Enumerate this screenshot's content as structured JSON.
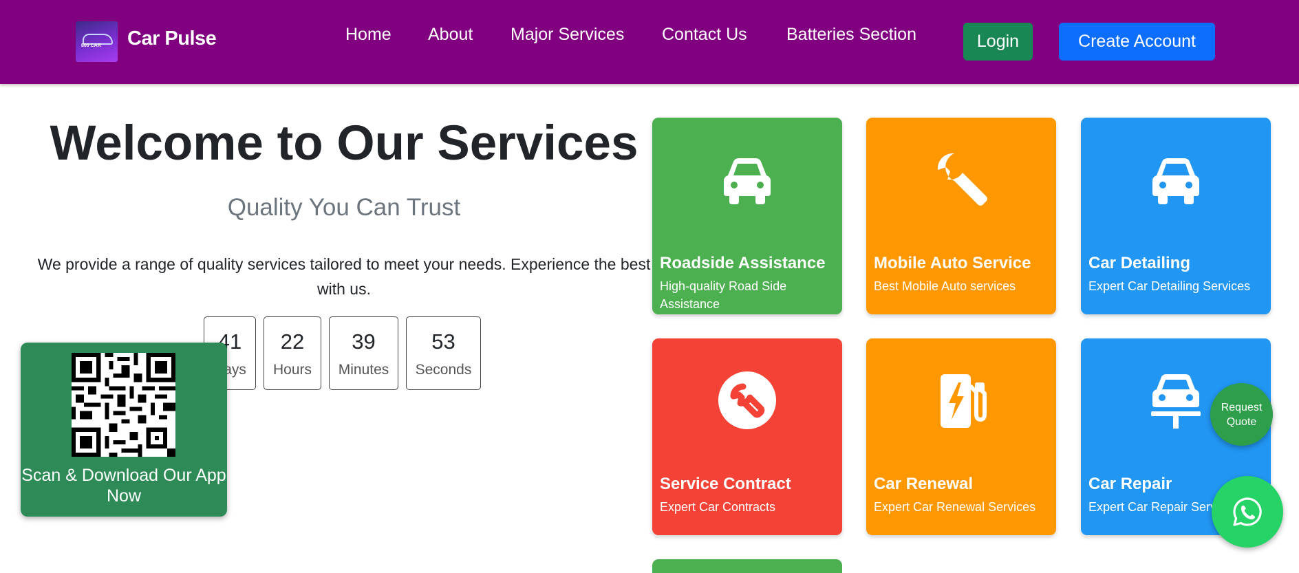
{
  "brand": {
    "name": "Car Pulse",
    "logo_text": "800 CAR"
  },
  "nav": {
    "links": [
      "Home",
      "About",
      "Major Services",
      "Contact Us",
      "Batteries Section"
    ],
    "login": "Login",
    "create_account": "Create Account"
  },
  "hero": {
    "title": "Welcome to Our Services",
    "subtitle": "Quality You Can Trust",
    "description": "We provide a range of quality services tailored to meet your needs. Experience the best with us."
  },
  "countdown": [
    {
      "value": "41",
      "label": "Days"
    },
    {
      "value": "22",
      "label": "Hours"
    },
    {
      "value": "39",
      "label": "Minutes"
    },
    {
      "value": "53",
      "label": "Seconds"
    }
  ],
  "qr": {
    "text": "Scan & Download Our App Now"
  },
  "services": [
    {
      "title": "Roadside Assistance",
      "desc": "High-quality Road Side Assistance",
      "color": "#4caf50",
      "icon": "car-icon"
    },
    {
      "title": "Mobile Auto Service",
      "desc": "Best Mobile Auto services",
      "color": "#ff9800",
      "icon": "wrench-icon"
    },
    {
      "title": "Car Detailing",
      "desc": "Expert Car Detailing Services",
      "color": "#2196f3",
      "icon": "car-icon"
    },
    {
      "title": "Service Contract",
      "desc": "Expert Car Contracts",
      "color": "#f44336",
      "icon": "wrench-circle-icon"
    },
    {
      "title": "Car Renewal",
      "desc": "Expert Car Renewal Services",
      "color": "#ff9800",
      "icon": "charging-station-icon"
    },
    {
      "title": "Car Repair",
      "desc": "Expert Car Repair Services",
      "color": "#2196f3",
      "icon": "car-lift-icon"
    }
  ],
  "floating": {
    "request_quote": "Request Quote"
  }
}
